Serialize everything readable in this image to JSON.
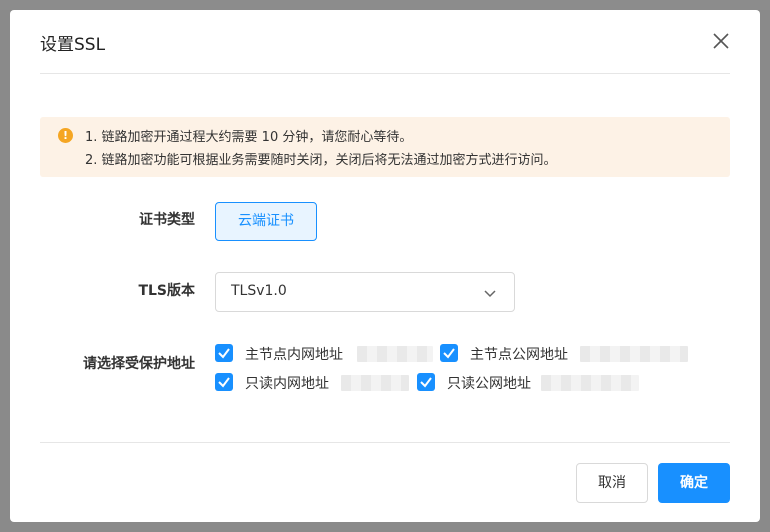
{
  "dialog": {
    "title": "设置SSL",
    "close_icon": "close-icon"
  },
  "notice": {
    "icon": "warning-icon",
    "icon_glyph": "!",
    "line1": "1. 链路加密开通过程大约需要 10 分钟，请您耐心等待。",
    "line2": "2. 链路加密功能可根据业务需要随时关闭，关闭后将无法通过加密方式进行访问。"
  },
  "form": {
    "cert_type": {
      "label": "证书类型",
      "option": "云端证书"
    },
    "tls": {
      "label": "TLS版本",
      "value": "TLSv1.0"
    },
    "addresses": {
      "label": "请选择受保护地址",
      "items": [
        {
          "label": "主节点内网地址",
          "checked": true
        },
        {
          "label": "主节点公网地址",
          "checked": true
        },
        {
          "label": "只读内网地址",
          "checked": true
        },
        {
          "label": "只读公网地址",
          "checked": true
        }
      ]
    }
  },
  "footer": {
    "cancel": "取消",
    "ok": "确定"
  },
  "colors": {
    "primary": "#1890ff",
    "notice_bg": "#fdf2e6",
    "warning": "#f5a623"
  }
}
